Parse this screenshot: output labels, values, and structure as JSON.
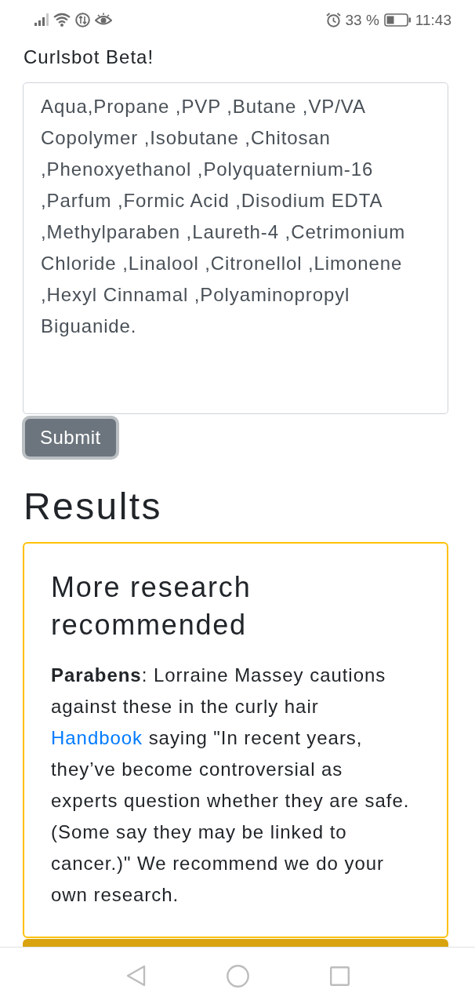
{
  "status_bar": {
    "battery": "33 %",
    "time": "11:43"
  },
  "app_title": "Curlsbot Beta!",
  "ingredients": {
    "value": "Aqua,Propane ,PVP ,Butane ,VP/VA Copolymer ,Isobutane ,Chitosan ,Phenoxyethanol ,Polyquaternium-16 ,Parfum ,Formic Acid ,Disodium EDTA ,Methylparaben ,Laureth-4 ,Cetrimonium Chloride ,Linalool ,Citronellol ,Limonene ,Hexyl Cinnamal ,Polyaminopropyl Biguanide."
  },
  "submit": {
    "label": "Submit",
    "focused": true
  },
  "results": {
    "heading": "Results",
    "cards": [
      {
        "title": "More research recommended",
        "text_before": "**Parabens**: Lorraine Massey cautions against these in the curly hair ",
        "link": "Handbook",
        "text_after": " saying \"In recent years, they’ve become controversial as experts question whether they are safe. (Some say they may be linked to cancer.)\" We recommend we do your own research."
      }
    ]
  }
}
